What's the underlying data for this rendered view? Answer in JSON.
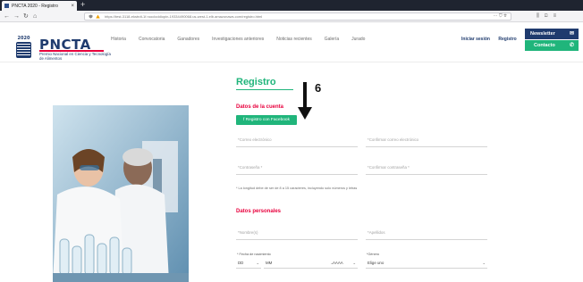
{
  "browser": {
    "tab_title": "PNCTA 2020 - Registro",
    "tab_close": "×",
    "newtab": "+",
    "url": "https://test-3118-ekstrdt-1f.roocloddiopin-19334490068.us-west-1.elb.amazonaws.com/registro.html",
    "url_right": "··· ⛉ ☆"
  },
  "header": {
    "logo_year": "2020",
    "logo_brand": "PNCTA",
    "logo_subtitle": "Premio Nacional en Ciencia y Tecnología de Alimentos",
    "nav": [
      "Historia",
      "Convocatoria",
      "Ganadores",
      "Investigaciones anteriores",
      "Noticias recientes",
      "Galería",
      "Jurado"
    ],
    "login": "Iniciar sesión",
    "register": "Registro",
    "newsletter": "Newsletter",
    "contact": "Contacto",
    "newsletter_icon": "mail-icon",
    "contact_icon": "phone-icon"
  },
  "page": {
    "title": "Registro",
    "annotation_number": "6",
    "account_section": "Datos de la cuenta",
    "facebook_button": "f Registro con Facebook",
    "email_placeholder": "*Correo electrónico",
    "confirm_email_placeholder": "*Confirmar correo electrónico",
    "password_placeholder": "*Contraseña *",
    "confirm_password_placeholder": "*Confirmar contraseña *",
    "password_note": "* La longitud debe de ser de 8 a 15 caracteres, incluyendo solo números y letras",
    "personal_section": "Datos personales",
    "name_placeholder": "*Nombre(s)",
    "lastname_placeholder": "*Apellidos",
    "birthdate_label": "* Fecha de nacimiento",
    "day": "DD",
    "month": "MM",
    "year": "AAAA",
    "gender_label": "*Género",
    "gender_value": "Elige uno",
    "chevron": "⌄"
  },
  "colors": {
    "brand_blue": "#1f3b6e",
    "accent_green": "#20b57b",
    "accent_red": "#e8003d"
  }
}
